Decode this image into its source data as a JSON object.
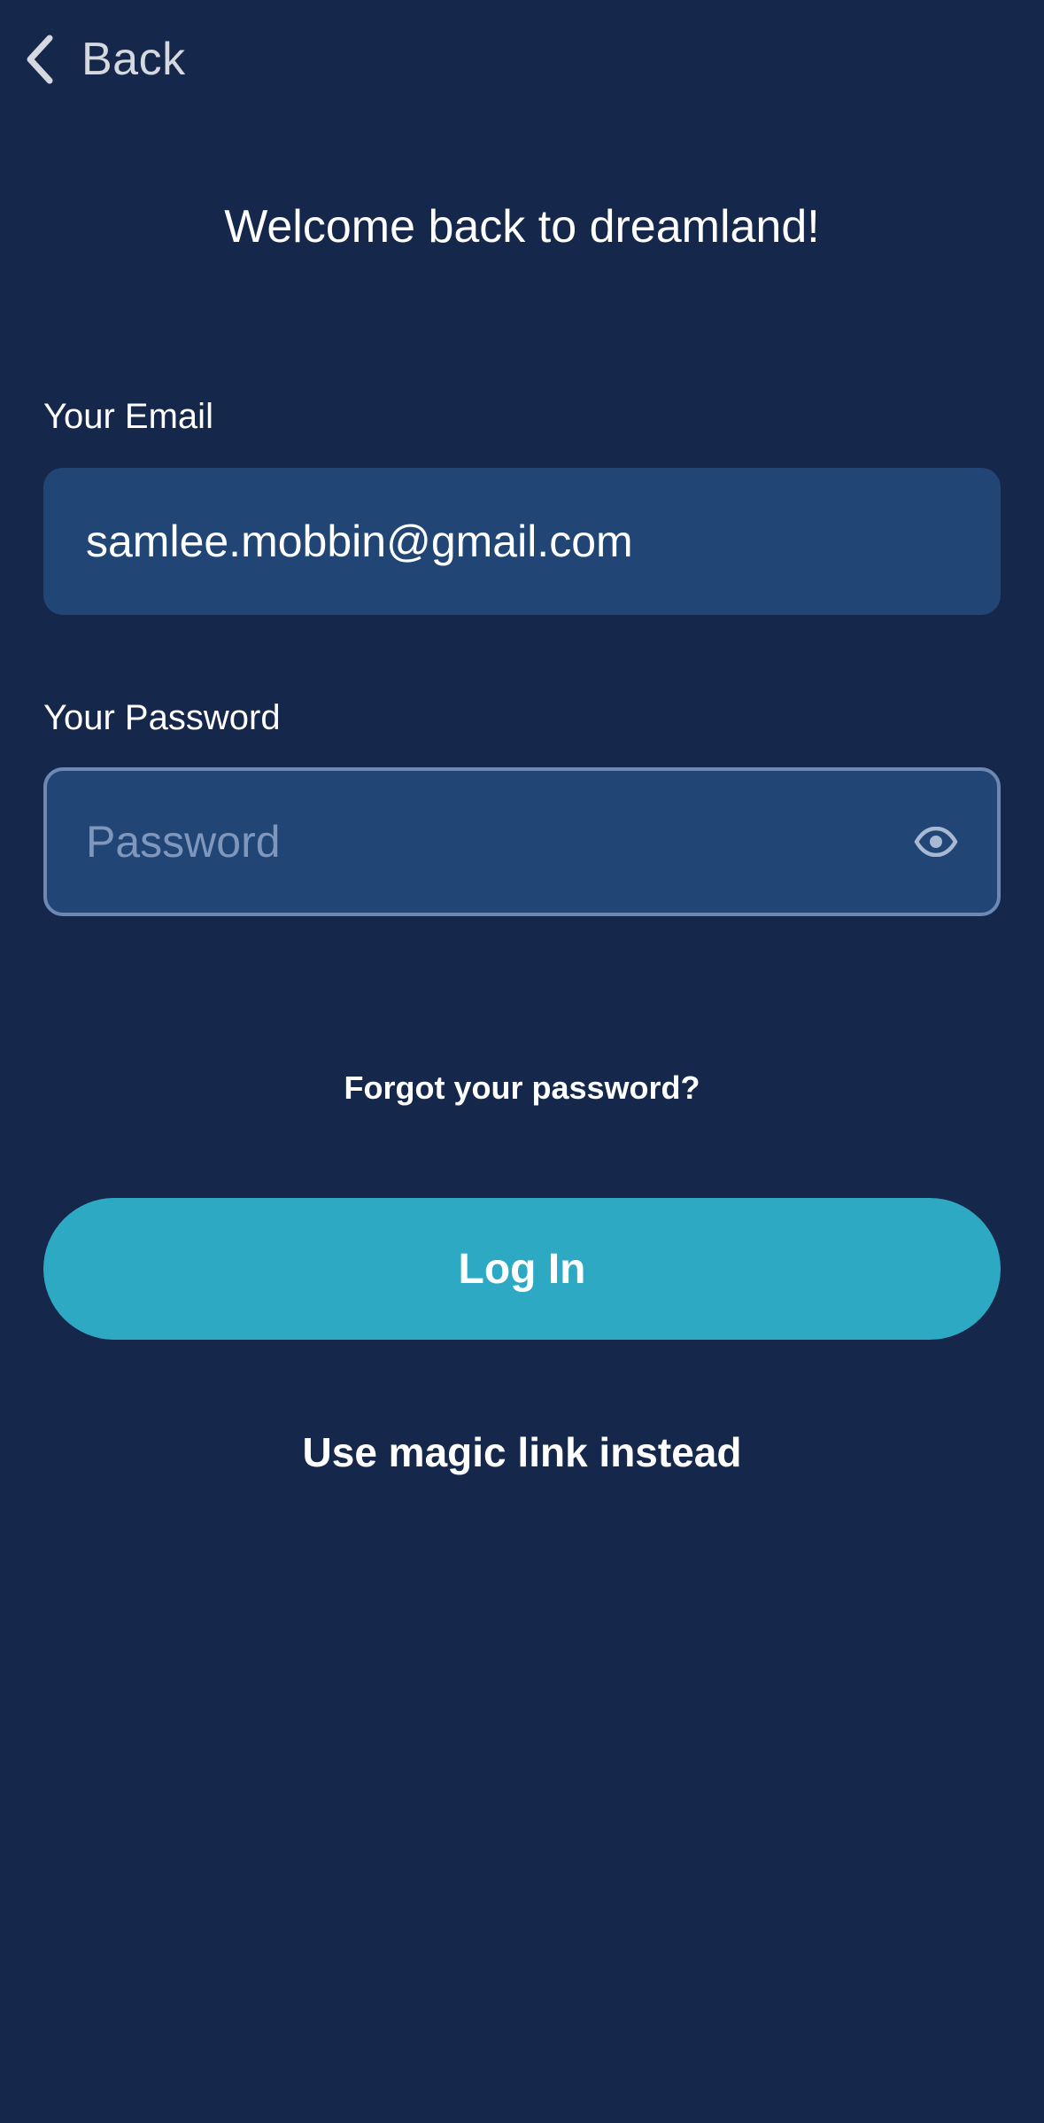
{
  "nav": {
    "back_icon": "chevron-left-icon",
    "back_label": "Back"
  },
  "header": {
    "title": "Welcome back to dreamland!"
  },
  "form": {
    "email_label": "Your Email",
    "email_value": "samlee.mobbin@gmail.com",
    "password_label": "Your Password",
    "password_placeholder": "Password",
    "password_visibility_icon": "eye-icon"
  },
  "actions": {
    "forgot_password": "Forgot your password?",
    "login": "Log In",
    "magic_link": "Use magic link instead"
  },
  "colors": {
    "background": "#15274a",
    "input_background": "#214675",
    "input_focus_border": "#6f88b3",
    "primary_button": "#2ea9c3",
    "placeholder": "#7f97bd"
  }
}
